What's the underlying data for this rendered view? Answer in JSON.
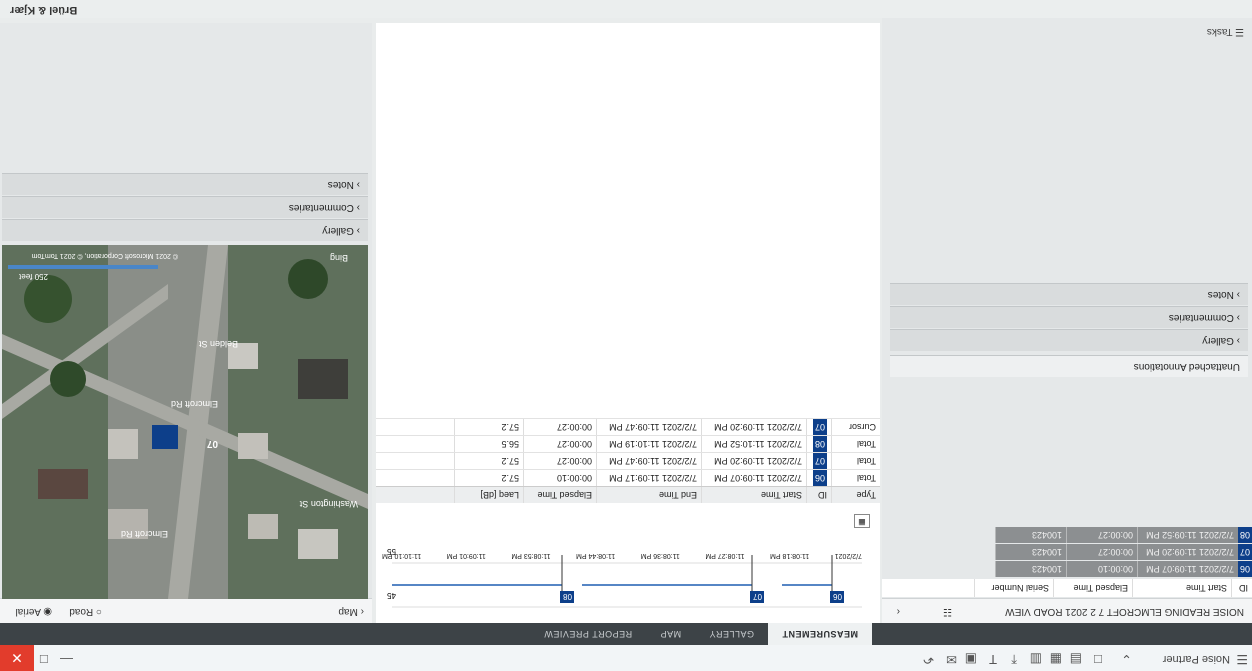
{
  "titlebar": {
    "app": "Noise Partner"
  },
  "tabs": [
    "MEASUREMENT",
    "GALLERY",
    "MAP",
    "REPORT PREVIEW"
  ],
  "left": {
    "project_title": "NOISE READING ELMCROFT 7 2 2021 ROAD VIEW",
    "columns": [
      "ID",
      "Start Time",
      "Elapsed Time",
      "Serial Number"
    ],
    "rows": [
      {
        "id": "06",
        "start": "7/2/2021 11:09:07 PM",
        "elapsed": "00:00:10",
        "serial": "100423"
      },
      {
        "id": "07",
        "start": "7/2/2021 11:09:20 PM",
        "elapsed": "00:00:27",
        "serial": "100423"
      },
      {
        "id": "08",
        "start": "7/2/2021 11:09:52 PM",
        "elapsed": "00:00:27",
        "serial": "100423"
      }
    ],
    "unattached": "Unattached Annotations",
    "sections": [
      "Gallery",
      "Commentaries",
      "Notes"
    ],
    "tasks": "Tasks"
  },
  "center": {
    "chart_data": {
      "type": "line",
      "title": "",
      "x_tick_labels": [
        "7/2/2021",
        "11:08:18 PM",
        "11:08:27 PM",
        "11:08:36 PM",
        "11:08:44 PM",
        "11:08:53 PM",
        "11:09:01 PM",
        "11:10:10 PM"
      ],
      "y_tick_labels": [
        "45",
        "55"
      ],
      "markers": [
        "06",
        "07",
        "08"
      ]
    },
    "table": {
      "columns": [
        "Type",
        "ID",
        "Start Time",
        "End Time",
        "Elapsed Time",
        "Laeq [dB]"
      ],
      "rows": [
        {
          "type": "Total",
          "id": "06",
          "start": "7/2/2021 11:09:07 PM",
          "end": "7/2/2021 11:09:17 PM",
          "elapsed": "00:00:10",
          "laeq": "57.2"
        },
        {
          "type": "Total",
          "id": "07",
          "start": "7/2/2021 11:09:20 PM",
          "end": "7/2/2021 11:09:47 PM",
          "elapsed": "00:00:27",
          "laeq": "57.2"
        },
        {
          "type": "Total",
          "id": "08",
          "start": "7/2/2021 11:10:52 PM",
          "end": "7/2/2021 11:10:19 PM",
          "elapsed": "00:00:27",
          "laeq": "56.5"
        },
        {
          "type": "Cursor",
          "id": "07",
          "start": "7/2/2021 11:09:20 PM",
          "end": "7/2/2021 11:09:47 PM",
          "elapsed": "00:00:27",
          "laeq": "57.2"
        }
      ]
    }
  },
  "right": {
    "map_header": "Map",
    "map_options": [
      "Road",
      "Aerial"
    ],
    "map_pin": "07",
    "streets": [
      "Elmcroft Rd",
      "Belden St",
      "Elmcroft Rd",
      "Washington St"
    ],
    "scale": "250 feet",
    "copyright": "© 2021 Microsoft Corporation, © 2021 TomTom",
    "bing": "Bing",
    "sections": [
      "Gallery",
      "Commentaries",
      "Notes"
    ]
  },
  "footer": {
    "brand": "Brüel & Kjær"
  }
}
